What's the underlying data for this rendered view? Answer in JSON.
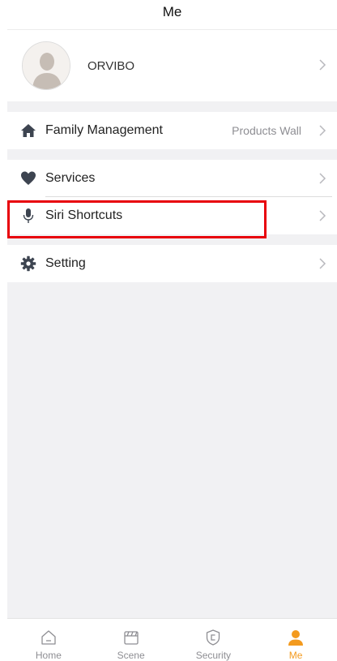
{
  "header": {
    "title": "Me"
  },
  "profile": {
    "name": "ORVIBO"
  },
  "menu": {
    "family": {
      "label": "Family Management",
      "value": "Products Wall"
    },
    "services": {
      "label": "Services"
    },
    "siri": {
      "label": "Siri Shortcuts"
    },
    "setting": {
      "label": "Setting"
    }
  },
  "tabbar": {
    "items": [
      {
        "label": "Home",
        "icon": "home-icon"
      },
      {
        "label": "Scene",
        "icon": "scene-icon"
      },
      {
        "label": "Security",
        "icon": "security-icon"
      },
      {
        "label": "Me",
        "icon": "person-icon",
        "active": true
      }
    ]
  },
  "colors": {
    "accent": "#f39a1e",
    "highlight": "#e8000b",
    "background": "#f1f1f3"
  }
}
